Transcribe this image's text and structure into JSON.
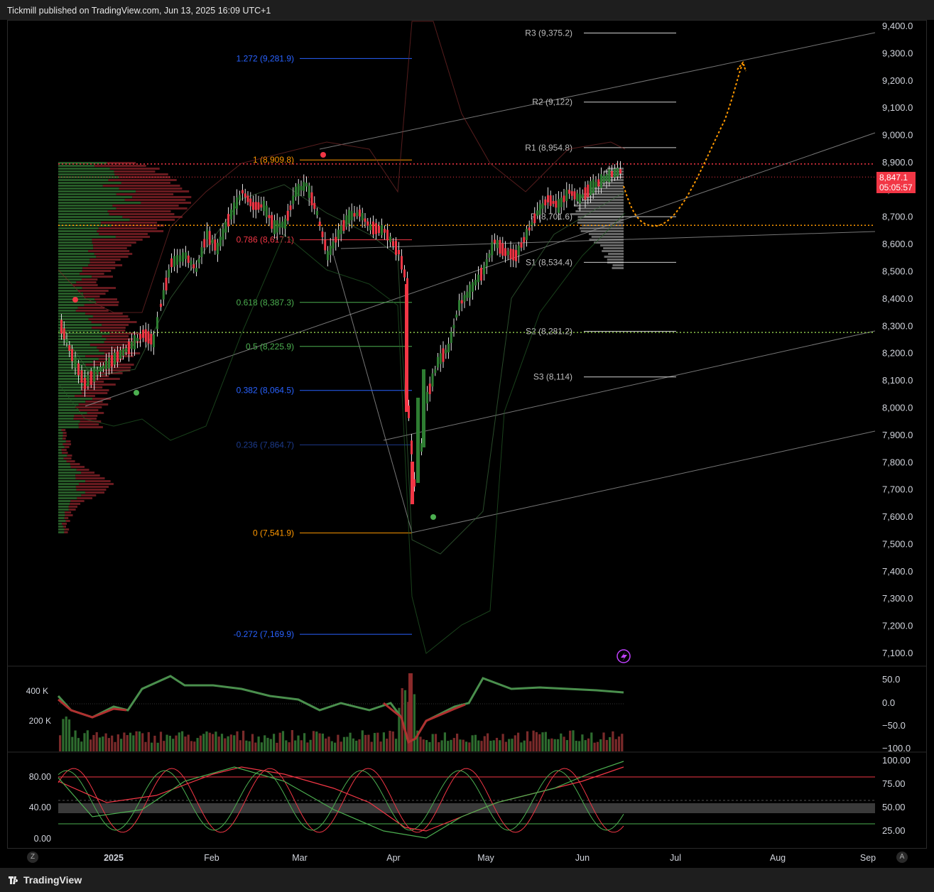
{
  "header": {
    "title": "Tickmill published on TradingView.com, Jun 13, 2025 16:09 UTC+1"
  },
  "footer": {
    "logo_text": "TradingView",
    "left_button": "Z",
    "right_button": "A"
  },
  "price_tag": {
    "price": "8,847.1",
    "countdown": "05:05:57"
  },
  "colors": {
    "up": "#2e7d32",
    "down": "#f23645",
    "fib_blue": "#2962ff",
    "fib_red": "#f23645",
    "fib_orange": "#ff9800",
    "fib_green": "#4caf50",
    "channel": "#9e9e9e"
  },
  "chart_data": [
    {
      "type": "candlestick",
      "price_axis": {
        "ticks": [
          "9,400.0",
          "9,300.0",
          "9,200.0",
          "9,100.0",
          "9,000.0",
          "8,900.0",
          "8,800.0",
          "8,700.0",
          "8,600.0",
          "8,500.0",
          "8,400.0",
          "8,300.0",
          "8,200.0",
          "8,100.0",
          "8,000.0",
          "7,900.0",
          "7,800.0",
          "7,700.0",
          "7,600.0",
          "7,500.0",
          "7,400.0",
          "7,300.0",
          "7,200.0",
          "7,100.0"
        ],
        "range": [
          7070,
          9425
        ]
      },
      "time_axis": {
        "ticks": [
          "2025",
          "Feb",
          "Mar",
          "Apr",
          "May",
          "Jun",
          "Jul",
          "Aug",
          "Sep"
        ]
      },
      "fib_levels": [
        {
          "label": "1.272 (9,281.9)",
          "value": 9281.9,
          "color": "#2962ff"
        },
        {
          "label": "1 (8,909.8)",
          "value": 8909.8,
          "color": "#ff9800"
        },
        {
          "label": "0.786 (8,617.1)",
          "value": 8617.1,
          "color": "#f23645"
        },
        {
          "label": "0.618 (8,387.3)",
          "value": 8387.3,
          "color": "#4caf50"
        },
        {
          "label": "0.5 (8,225.9)",
          "value": 8225.9,
          "color": "#4caf50"
        },
        {
          "label": "0.382 (8,064.5)",
          "value": 8064.5,
          "color": "#2962ff"
        },
        {
          "label": "0.236 (7,864.7)",
          "value": 7864.7,
          "color": "#1c3a8a"
        },
        {
          "label": "0 (7,541.9)",
          "value": 7541.9,
          "color": "#ff9800"
        },
        {
          "label": "-0.272 (7,169.9)",
          "value": 7169.9,
          "color": "#2962ff"
        }
      ],
      "pivot_levels": [
        {
          "label": "R3 (9,375.2)",
          "value": 9375.2
        },
        {
          "label": "R2 (9,122)",
          "value": 9122
        },
        {
          "label": "R1 (8,954.8)",
          "value": 8954.8
        },
        {
          "label": "P (8,701.6)",
          "value": 8701.6
        },
        {
          "label": "S1 (8,534.4)",
          "value": 8534.4
        },
        {
          "label": "S2 (8,281.2)",
          "value": 8281.2
        },
        {
          "label": "S3 (8,114)",
          "value": 8114
        }
      ],
      "horizontal_levels": [
        {
          "value": 8895,
          "color": "#f23645",
          "style": "dotted"
        },
        {
          "value": 8670,
          "color": "#ff9800",
          "style": "dotted"
        },
        {
          "value": 8277,
          "color": "#8bc34a",
          "style": "dotted"
        }
      ],
      "last_price": 8847.1
    },
    {
      "type": "bar",
      "name": "volume",
      "left_axis": [
        "400 K",
        "200 K"
      ],
      "right_axis": [
        "50.0",
        "0.0",
        "−50.0",
        "−100.0"
      ]
    },
    {
      "type": "line",
      "name": "stochastic",
      "left_axis": [
        "80.00",
        "40.00",
        "0.00"
      ],
      "right_axis": [
        "100.00",
        "75.00",
        "50.00",
        "25.00"
      ]
    }
  ]
}
